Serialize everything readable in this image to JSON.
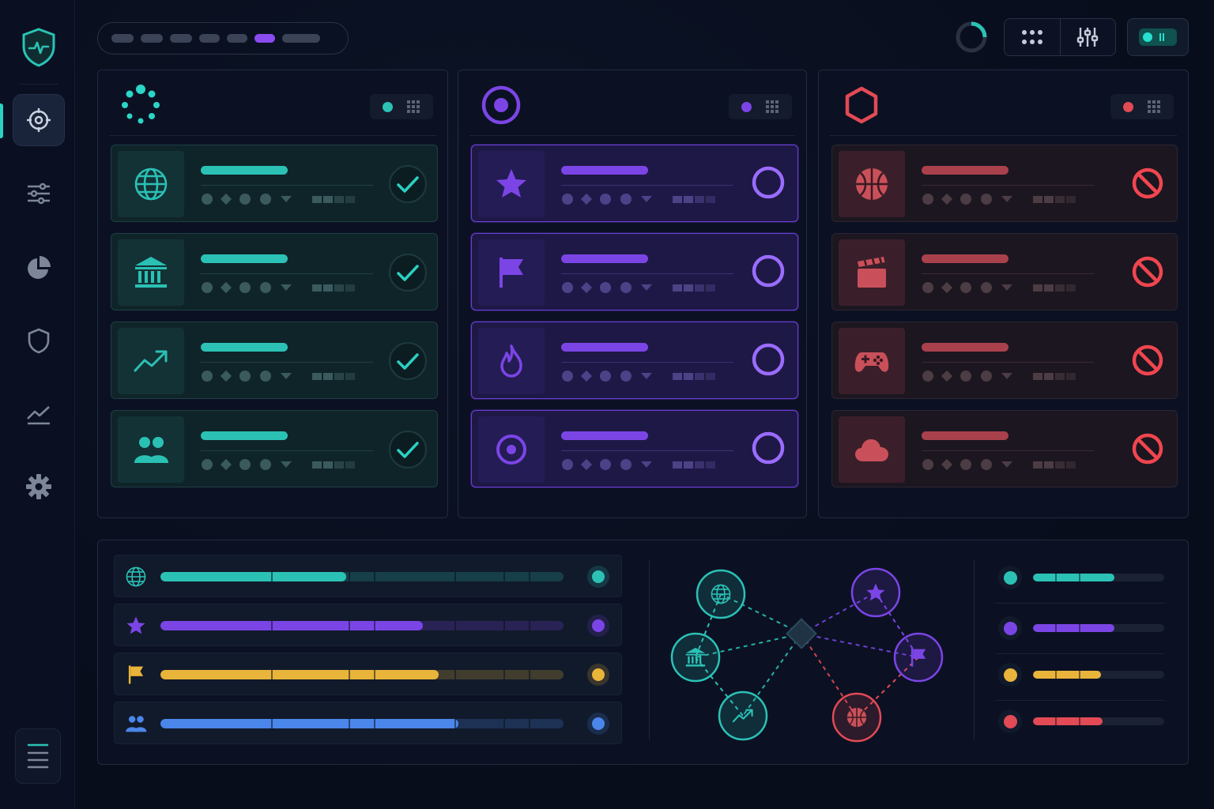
{
  "theme": {
    "teal": "#2bc2b5",
    "purple": "#7b45e6",
    "red": "#e24a55",
    "yellow": "#e9b43a",
    "blue": "#4b86ea"
  },
  "sidebar": {
    "logo_icon": "shield-pulse-icon",
    "items": [
      {
        "icon": "target-icon",
        "active": true
      },
      {
        "icon": "sliders-icon",
        "active": false
      },
      {
        "icon": "pie-chart-icon",
        "active": false
      },
      {
        "icon": "shield-icon",
        "active": false
      },
      {
        "icon": "line-chart-icon",
        "active": false
      },
      {
        "icon": "gear-icon",
        "active": false
      }
    ],
    "menu_icon": "hamburger-icon"
  },
  "topbar": {
    "breadcrumb_active_index": 5,
    "tools": [
      "grid-dots-icon",
      "equalizer-icon"
    ],
    "toggle_on": true
  },
  "panels": [
    {
      "id": "approved",
      "color": "#2bc2b5",
      "header_icon": "dotted-ring-icon",
      "status_icon": "check-circle-icon",
      "cards": [
        {
          "icon": "globe-icon"
        },
        {
          "icon": "bank-icon"
        },
        {
          "icon": "trend-up-icon"
        },
        {
          "icon": "users-icon"
        }
      ]
    },
    {
      "id": "pending",
      "color": "#7b45e6",
      "header_icon": "target-ring-icon",
      "status_icon": "empty-circle-icon",
      "cards": [
        {
          "icon": "star-icon"
        },
        {
          "icon": "flag-icon"
        },
        {
          "icon": "flame-icon"
        },
        {
          "icon": "target-icon"
        }
      ]
    },
    {
      "id": "blocked",
      "color": "#e24a55",
      "header_icon": "hexagon-icon",
      "status_icon": "blocked-icon",
      "cards": [
        {
          "icon": "basketball-icon"
        },
        {
          "icon": "clapperboard-icon"
        },
        {
          "icon": "gamepad-icon"
        },
        {
          "icon": "cloud-icon"
        }
      ]
    }
  ],
  "progress_rows": [
    {
      "icon": "globe-icon",
      "color": "#2bc2b5",
      "value": 0.46
    },
    {
      "icon": "star-icon",
      "color": "#7b45e6",
      "value": 0.65
    },
    {
      "icon": "flag-icon",
      "color": "#e9b43a",
      "value": 0.69
    },
    {
      "icon": "users-icon",
      "color": "#4b86ea",
      "value": 0.74
    }
  ],
  "network": {
    "hub": "diamond-hub-icon",
    "nodes": [
      {
        "icon": "globe-icon",
        "color": "#2bc2b5"
      },
      {
        "icon": "bank-icon",
        "color": "#2bc2b5"
      },
      {
        "icon": "trend-up-icon",
        "color": "#2bc2b5"
      },
      {
        "icon": "star-icon",
        "color": "#7b45e6"
      },
      {
        "icon": "flag-icon",
        "color": "#7b45e6"
      },
      {
        "icon": "basketball-icon",
        "color": "#e24a55"
      }
    ]
  },
  "legend": [
    {
      "color": "#2bc2b5",
      "value": 0.62
    },
    {
      "color": "#7b45e6",
      "value": 0.62
    },
    {
      "color": "#e9b43a",
      "value": 0.52
    },
    {
      "color": "#e24a55",
      "value": 0.53
    }
  ]
}
